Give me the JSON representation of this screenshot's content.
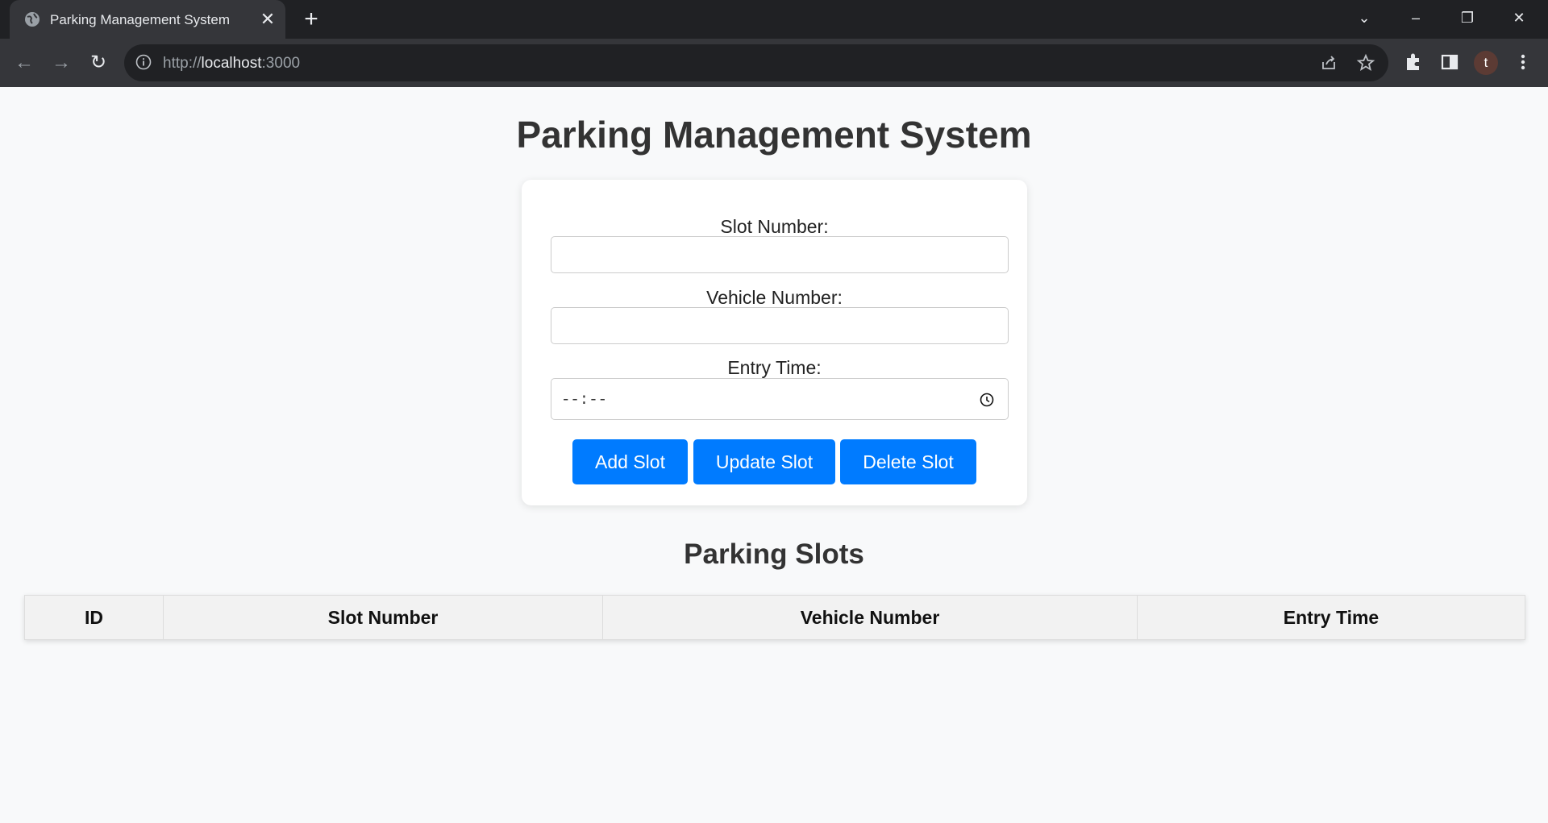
{
  "browser": {
    "tab_title": "Parking Management System",
    "url_scheme": "http://",
    "url_host": "localhost",
    "url_port": ":3000",
    "profile_initial": "t"
  },
  "page": {
    "title": "Parking Management System",
    "form": {
      "slot_label": "Slot Number:",
      "slot_value": "",
      "vehicle_label": "Vehicle Number:",
      "vehicle_value": "",
      "entry_label": "Entry Time:",
      "entry_placeholder": "--:--",
      "add_button": "Add Slot",
      "update_button": "Update Slot",
      "delete_button": "Delete Slot"
    },
    "slots_heading": "Parking Slots",
    "table": {
      "headers": [
        "ID",
        "Slot Number",
        "Vehicle Number",
        "Entry Time"
      ],
      "rows": []
    }
  },
  "colors": {
    "accent": "#007bff",
    "page_bg": "#f8f9fa"
  }
}
